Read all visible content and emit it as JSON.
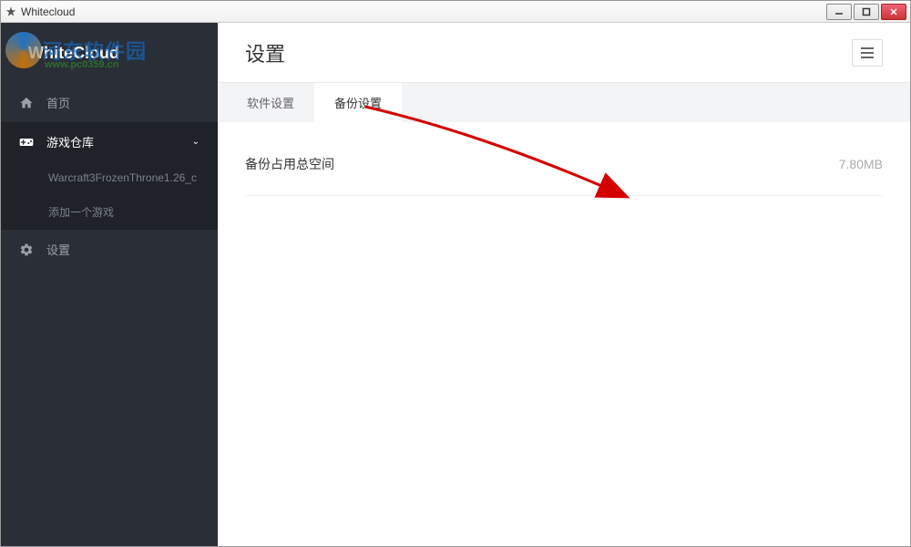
{
  "window": {
    "title": "Whitecloud"
  },
  "watermark": {
    "text": "河东软件园",
    "url": "www.pc0359.cn"
  },
  "brand": {
    "name": "WhiteCloud"
  },
  "sidebar": {
    "items": [
      {
        "icon": "home",
        "label": "首页"
      },
      {
        "icon": "gamepad",
        "label": "游戏仓库",
        "expanded": true,
        "children": [
          {
            "label": "Warcraft3FrozenThrone1.26_c"
          },
          {
            "label": "添加一个游戏"
          }
        ]
      },
      {
        "icon": "gear",
        "label": "设置",
        "active": true
      }
    ]
  },
  "header": {
    "title": "设置"
  },
  "tabs": [
    {
      "label": "软件设置",
      "active": false
    },
    {
      "label": "备份设置",
      "active": true
    }
  ],
  "content": {
    "backup_stat_label": "备份占用总空间",
    "backup_stat_value": "7.80MB"
  }
}
